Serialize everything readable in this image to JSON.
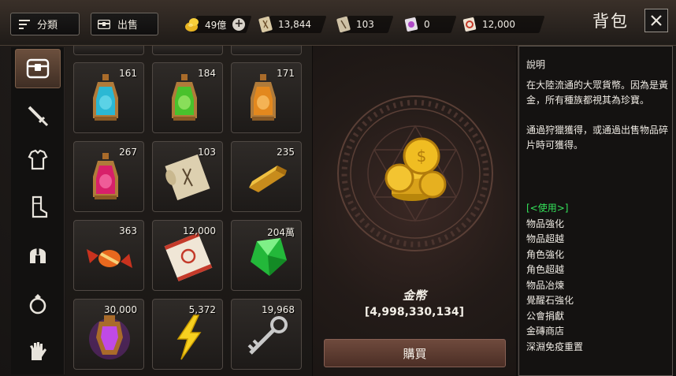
{
  "toolbar": {
    "sort_label": "分類",
    "sell_label": "出售"
  },
  "currencies": [
    {
      "name": "gold-ingot-icon",
      "value": "49億"
    },
    {
      "name": "scroll-gold-icon",
      "value": "13,844"
    },
    {
      "name": "scroll-plain-icon",
      "value": "103"
    },
    {
      "name": "purple-scroll-icon",
      "value": "0"
    },
    {
      "name": "red-scroll-icon",
      "value": "12,000"
    }
  ],
  "header": {
    "title": "背包",
    "close_icon": "close-icon"
  },
  "sidebar": {
    "categories": [
      {
        "name": "chest-icon",
        "active": true
      },
      {
        "name": "sword-icon",
        "active": false
      },
      {
        "name": "armor-icon",
        "active": false
      },
      {
        "name": "boots-icon",
        "active": false
      },
      {
        "name": "helmet-icon",
        "active": false
      },
      {
        "name": "ring-icon",
        "active": false
      },
      {
        "name": "gloves-icon",
        "active": false
      }
    ]
  },
  "grid": {
    "items": [
      {
        "name": "blue-potion-icon",
        "qty": "161"
      },
      {
        "name": "green-potion-icon",
        "qty": "184"
      },
      {
        "name": "orange-potion-icon",
        "qty": "171"
      },
      {
        "name": "pink-potion-icon",
        "qty": "267"
      },
      {
        "name": "paper-scroll-icon",
        "qty": "103"
      },
      {
        "name": "gold-bar-icon",
        "qty": "235"
      },
      {
        "name": "candy-icon",
        "qty": "363"
      },
      {
        "name": "sun-scroll-icon",
        "qty": "12,000"
      },
      {
        "name": "green-gem-icon",
        "qty": "204萬"
      },
      {
        "name": "purple-lantern-icon",
        "qty": "30,000"
      },
      {
        "name": "lightning-icon",
        "qty": "5,372"
      },
      {
        "name": "key-icon",
        "qty": "19,968"
      }
    ]
  },
  "detail": {
    "item_name": "金幣",
    "amount": "[4,998,330,134]",
    "buy_label": "購買"
  },
  "description": {
    "title": "說明",
    "paragraphs": [
      "在大陸流通的大眾貨幣。因為是黃金，所有種族都視其為珍寶。",
      "通過狩獵獲得，或通過出售物品碎片時可獲得。"
    ],
    "use_heading": "[<使用>]",
    "uses": [
      "物品強化",
      "物品超越",
      "角色強化",
      "角色超越",
      "物品冶煉",
      "覺醒石強化",
      "公會捐獻",
      "金磚商店",
      "深淵免疫重置"
    ]
  },
  "colors": {
    "accent_green": "#34e35a",
    "buy_button": "#5e3b30",
    "panel_border": "#5c5550"
  }
}
